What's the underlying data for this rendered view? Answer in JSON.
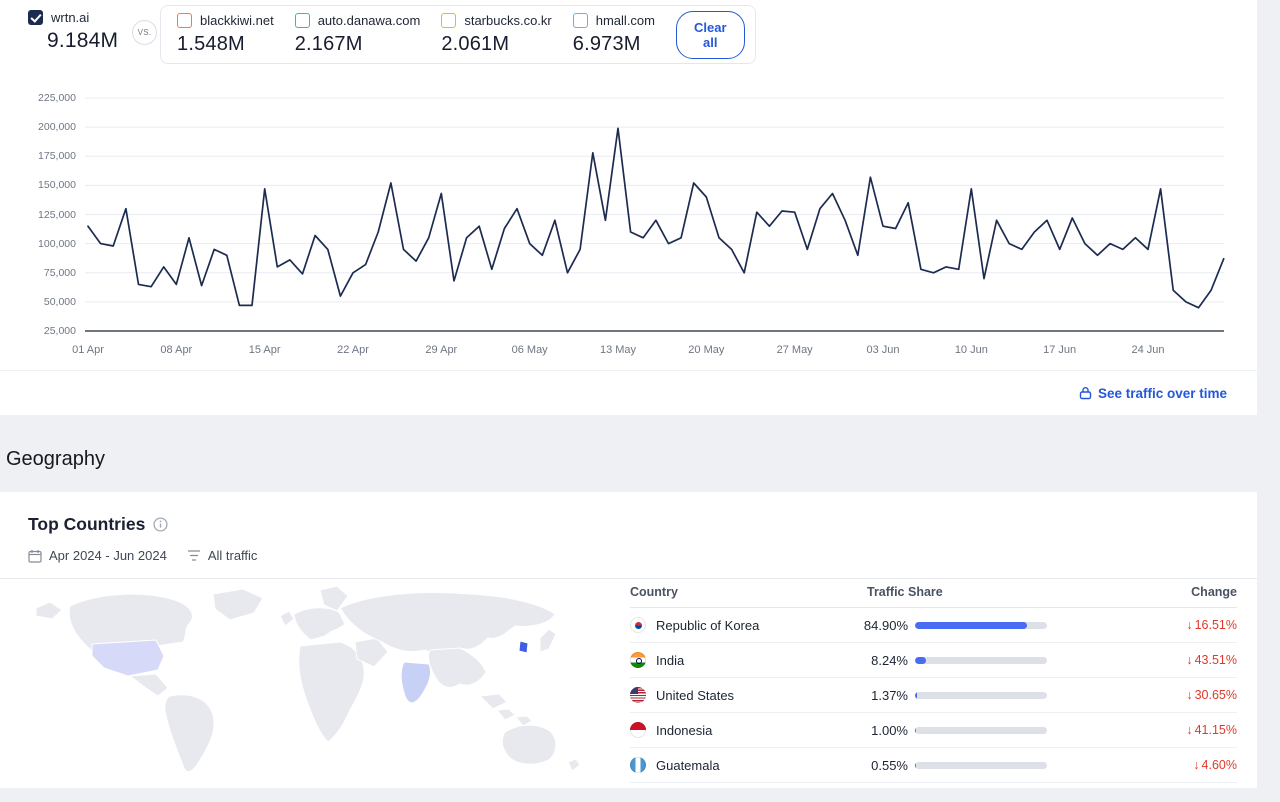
{
  "compare_bar": {
    "primary": {
      "label": "wrtn.ai",
      "value": "9.184M",
      "color": "#1c2b50"
    },
    "vs_label": "VS.",
    "competitors": [
      {
        "label": "blackkiwi.net",
        "value": "1.548M",
        "color": "#ef7d3b"
      },
      {
        "label": "auto.danawa.com",
        "value": "2.167M",
        "color": "#3cb9a0"
      },
      {
        "label": "starbucks.co.kr",
        "value": "2.061M",
        "color": "#f0b42e"
      },
      {
        "label": "hmall.com",
        "value": "6.973M",
        "color": "#5fb5e8"
      }
    ],
    "clear_all_label": "Clear all"
  },
  "chart_data": {
    "type": "line",
    "grid": "horizontal",
    "legend": "none",
    "line_color": "#1c2b50",
    "ylim": [
      25000,
      225000
    ],
    "y_ticks": [
      225000,
      200000,
      175000,
      150000,
      125000,
      100000,
      75000,
      50000,
      25000
    ],
    "x_tick_labels": [
      "01 Apr",
      "08 Apr",
      "15 Apr",
      "22 Apr",
      "29 Apr",
      "06 May",
      "13 May",
      "20 May",
      "27 May",
      "03 Jun",
      "10 Jun",
      "17 Jun",
      "24 Jun"
    ],
    "x_tick_every_days": 7,
    "series": [
      {
        "name": "wrtn.ai",
        "values": [
          115000,
          100000,
          98000,
          130000,
          65000,
          63000,
          80000,
          65000,
          105000,
          64000,
          95000,
          90000,
          47000,
          47000,
          147000,
          80000,
          86000,
          74000,
          107000,
          95000,
          55000,
          75000,
          82000,
          110000,
          152000,
          95000,
          85000,
          105000,
          143000,
          68000,
          105000,
          115000,
          78000,
          113000,
          130000,
          100000,
          90000,
          120000,
          75000,
          95000,
          178000,
          120000,
          199000,
          110000,
          105000,
          120000,
          100000,
          105000,
          152000,
          140000,
          105000,
          95000,
          75000,
          127000,
          115000,
          128000,
          127000,
          95000,
          130000,
          143000,
          120000,
          90000,
          157000,
          115000,
          113000,
          135000,
          78000,
          75000,
          80000,
          78000,
          147000,
          70000,
          120000,
          100000,
          95000,
          110000,
          120000,
          95000,
          122000,
          100000,
          90000,
          100000,
          95000,
          105000,
          95000,
          147000,
          60000,
          50000,
          45000,
          60000,
          87000
        ]
      }
    ]
  },
  "traffic_link": {
    "label": "See traffic over time",
    "color": "#2457d9"
  },
  "geography": {
    "heading": "Geography",
    "card_title": "Top Countries",
    "date_range": "Apr 2024 - Jun 2024",
    "traffic_filter": "All traffic",
    "table": {
      "headers": {
        "country": "Country",
        "share": "Traffic Share",
        "change": "Change"
      },
      "bar_color": "#4a6cf3",
      "change_color": "#e0392b",
      "rows": [
        {
          "flag": "kr",
          "country": "Republic of Korea",
          "share": "84.90%",
          "share_pct": 84.9,
          "change_arrow": "↓",
          "change": "16.51%"
        },
        {
          "flag": "in",
          "country": "India",
          "share": "8.24%",
          "share_pct": 8.24,
          "change_arrow": "↓",
          "change": "43.51%"
        },
        {
          "flag": "us",
          "country": "United States",
          "share": "1.37%",
          "share_pct": 1.37,
          "change_arrow": "↓",
          "change": "30.65%"
        },
        {
          "flag": "id",
          "country": "Indonesia",
          "share": "1.00%",
          "share_pct": 1.0,
          "change_arrow": "↓",
          "change": "41.15%"
        },
        {
          "flag": "gt",
          "country": "Guatemala",
          "share": "0.55%",
          "share_pct": 0.55,
          "change_arrow": "↓",
          "change": "4.60%"
        }
      ]
    }
  }
}
